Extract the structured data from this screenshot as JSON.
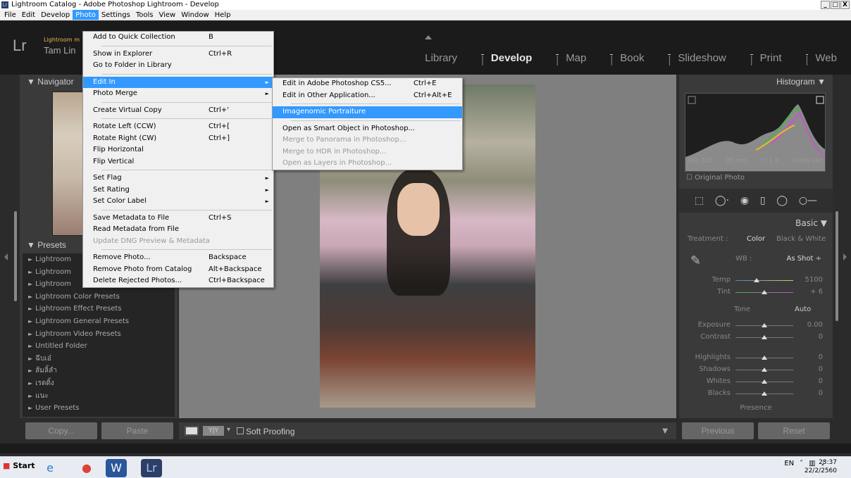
{
  "window": {
    "title": "Lightroom Catalog - Adobe Photoshop Lightroom - Develop",
    "icon": "Lr",
    "controls": [
      "_",
      "&#9633;",
      "X"
    ]
  },
  "menubar": [
    "File",
    "Edit",
    "Develop",
    "Photo",
    "Settings",
    "Tools",
    "View",
    "Window",
    "Help"
  ],
  "menubar_active": "Photo",
  "header": {
    "logo": "Lr",
    "identity_small": "Lightroom m",
    "identity": "Tam Lin"
  },
  "modules": [
    "Library",
    "Develop",
    "Map",
    "Book",
    "Slideshow",
    "Print",
    "Web"
  ],
  "module_active": "Develop",
  "left_panel": {
    "navigator": "Navigator",
    "presets_title": "Presets",
    "presets": [
      "Lightroom",
      "Lightroom",
      "Lightroom",
      "Lightroom Color Presets",
      "Lightroom Effect Presets",
      "Lightroom General Presets",
      "Lightroom Video Presets",
      "Untitled Folder",
      "ฉึบเอ๋",
      "ส้มลิ้ลำ",
      "เรดดิ้ง",
      "แนะ",
      "User Presets"
    ]
  },
  "left_buttons": {
    "copy": "Copy...",
    "paste": "Paste"
  },
  "bottom": {
    "soft_proofing": "Soft Proofing"
  },
  "right_panel": {
    "histogram": "Histogram",
    "iso": "ISO 320",
    "focal": "35 mm",
    "aperture": "f / 1.8",
    "shutter": "1/400 sec",
    "original_photo": "Original Photo",
    "basic": "Basic",
    "treatment": "Treatment :",
    "color": "Color",
    "bw": "Black & White",
    "wb_label": "WB :",
    "wb_value": "As Shot ÷",
    "temp_label": "Temp",
    "temp_value": "5100",
    "tint_label": "Tint",
    "tint_value": "+ 6",
    "tone": "Tone",
    "auto": "Auto",
    "exposure": "Exposure",
    "exposure_value": "0.00",
    "contrast": "Contrast",
    "contrast_value": "0",
    "highlights": "Highlights",
    "highlights_value": "0",
    "shadows": "Shadows",
    "shadows_value": "0",
    "whites": "Whites",
    "whites_value": "0",
    "blacks": "Blacks",
    "blacks_value": "0",
    "presence": "Presence"
  },
  "right_buttons": {
    "previous": "Previous",
    "reset": "Reset"
  },
  "photo_menu": [
    {
      "label": "Add to Quick Collection",
      "shortcut": "B"
    },
    {
      "sep": true
    },
    {
      "label": "Show in Explorer",
      "shortcut": "Ctrl+R"
    },
    {
      "label": "Go to Folder in Library",
      "shortcut": ""
    },
    {
      "sep": true
    },
    {
      "label": "Edit In",
      "shortcut": "",
      "submenu": true,
      "highlight": true
    },
    {
      "label": "Photo Merge",
      "shortcut": "",
      "submenu": true
    },
    {
      "sep": true
    },
    {
      "label": "Create Virtual Copy",
      "shortcut": "Ctrl+'"
    },
    {
      "sep": true
    },
    {
      "label": "Rotate Left (CCW)",
      "shortcut": "Ctrl+["
    },
    {
      "label": "Rotate Right (CW)",
      "shortcut": "Ctrl+]"
    },
    {
      "label": "Flip Horizontal",
      "shortcut": ""
    },
    {
      "label": "Flip Vertical",
      "shortcut": ""
    },
    {
      "sep": true
    },
    {
      "label": "Set Flag",
      "shortcut": "",
      "submenu": true
    },
    {
      "label": "Set Rating",
      "shortcut": "",
      "submenu": true
    },
    {
      "label": "Set Color Label",
      "shortcut": "",
      "submenu": true
    },
    {
      "sep": true
    },
    {
      "label": "Save Metadata to File",
      "shortcut": "Ctrl+S"
    },
    {
      "label": "Read Metadata from File",
      "shortcut": ""
    },
    {
      "label": "Update DNG Preview & Metadata",
      "shortcut": "",
      "disabled": true
    },
    {
      "sep": true
    },
    {
      "label": "Remove Photo...",
      "shortcut": "Backspace"
    },
    {
      "label": "Remove Photo from Catalog",
      "shortcut": "Alt+Backspace"
    },
    {
      "label": "Delete Rejected Photos...",
      "shortcut": "Ctrl+Backspace"
    }
  ],
  "editin_menu": [
    {
      "label": "Edit in Adobe Photoshop CS5...",
      "shortcut": "Ctrl+E"
    },
    {
      "label": "Edit in Other Application...",
      "shortcut": "Ctrl+Alt+E"
    },
    {
      "sep": true
    },
    {
      "label": "Imagenomic Portraiture",
      "shortcut": "",
      "highlight": true
    },
    {
      "sep": true
    },
    {
      "label": "Open as Smart Object in Photoshop...",
      "shortcut": ""
    },
    {
      "label": "Merge to Panorama in Photoshop...",
      "shortcut": "",
      "disabled": true
    },
    {
      "label": "Merge to HDR in Photoshop...",
      "shortcut": "",
      "disabled": true
    },
    {
      "label": "Open as Layers in Photoshop...",
      "shortcut": "",
      "disabled": true
    }
  ],
  "taskbar": {
    "start": "Start",
    "lang": "EN",
    "time": "23:37",
    "date": "22/2/2560"
  }
}
